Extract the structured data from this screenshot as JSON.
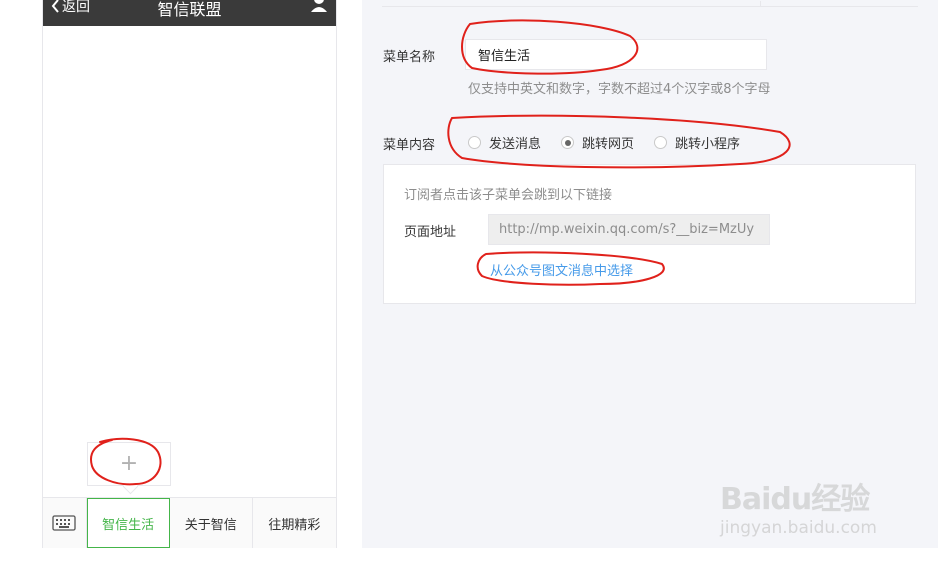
{
  "phone": {
    "back_label": "返回",
    "title": "智信联盟",
    "add_submenu_symbol": "+",
    "menu_items": [
      {
        "label": "智信生活",
        "active": true
      },
      {
        "label": "关于智信",
        "active": false
      },
      {
        "label": "往期精彩",
        "active": false
      }
    ]
  },
  "form": {
    "menu_name_label": "菜单名称",
    "menu_name_value": "智信生活",
    "menu_name_hint": "仅支持中英文和数字，字数不超过4个汉字或8个字母",
    "menu_content_label": "菜单内容",
    "options": [
      {
        "label": "发送消息",
        "checked": false
      },
      {
        "label": "跳转网页",
        "checked": true
      },
      {
        "label": "跳转小程序",
        "checked": false
      }
    ],
    "jump_description": "订阅者点击该子菜单会跳到以下链接",
    "page_url_label": "页面地址",
    "page_url_value": "http://mp.weixin.qq.com/s?__biz=MzUy",
    "pick_from_articles": "从公众号图文消息中选择"
  },
  "watermark": {
    "logo": "Baidu经验",
    "url": "jingyan.baidu.com"
  },
  "colors": {
    "accent_green": "#44b549",
    "link_blue": "#459ae9",
    "annotation_red": "#e0211b",
    "header_dark": "#3a3a3a"
  }
}
